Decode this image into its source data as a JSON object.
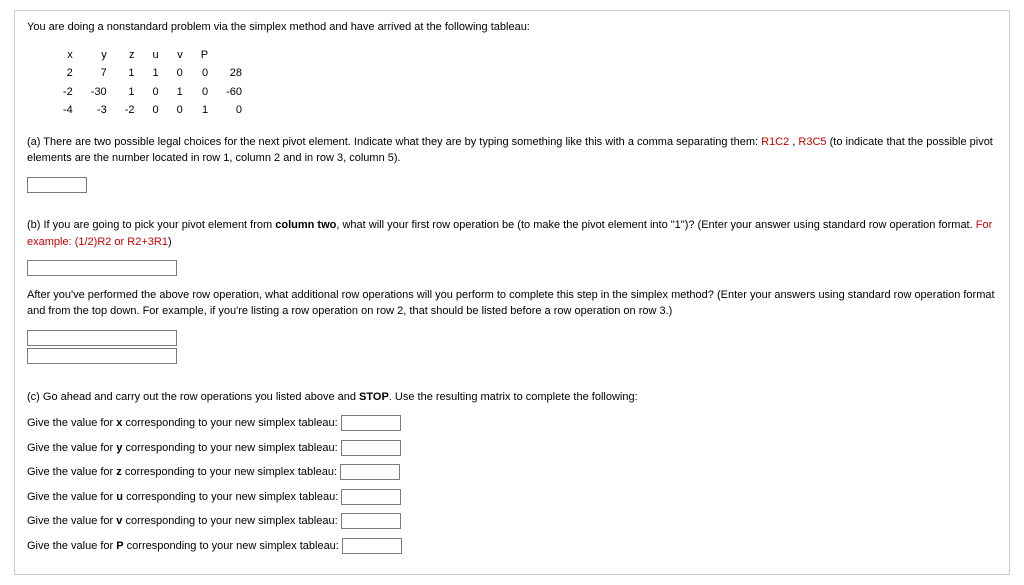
{
  "intro": "You are doing a nonstandard problem via the simplex method and have arrived at the following tableau:",
  "tableau": {
    "headers": [
      "x",
      "y",
      "z",
      "u",
      "v",
      "P",
      ""
    ],
    "rows": [
      [
        "2",
        "7",
        "1",
        "1",
        "0",
        "0",
        "28"
      ],
      [
        "-2",
        "-30",
        "1",
        "0",
        "1",
        "0",
        "-60"
      ],
      [
        "-4",
        "-3",
        "-2",
        "0",
        "0",
        "1",
        "0"
      ]
    ]
  },
  "partA": {
    "prefix": "(a) There are two possible legal choices for the next pivot element. Indicate what they are by typing something like this with a comma separating them: ",
    "ex1": "R1C2",
    "sep": " , ",
    "ex2": "R3C5",
    "suffix": " (to indicate that the possible pivot elements are the number located in row 1, column 2 and in row 3, column 5)."
  },
  "partB1": {
    "prefix": "(b) If you are going to pick your pivot element from ",
    "bold": "column two",
    "suffix": ", what will your first row operation be (to make the pivot element into \"1\")? (Enter your answer using standard row operation format. ",
    "example_lead": "For example:",
    "example_vals": " (1/2)R2 or R2+3R1",
    "close": ")"
  },
  "partB2": "After you've performed the above row operation, what additional row operations will you perform to complete this step in the simplex method? (Enter your answers using standard row operation format and from the top down. For example, if you're listing a row operation on row 2, that should be listed before a row operation on row 3.)",
  "partC": {
    "prefix": "(c) Go ahead and carry out the row operations you listed above and ",
    "stop": "STOP",
    "suffix": ". Use the resulting matrix to complete the following:"
  },
  "values": [
    {
      "pre": "Give the value for ",
      "var": "x",
      "post": " corresponding to your new simplex tableau:"
    },
    {
      "pre": "Give the value for ",
      "var": "y",
      "post": " corresponding to your new simplex tableau:"
    },
    {
      "pre": "Give the value for ",
      "var": "z",
      "post": " corresponding to your new simplex tableau:"
    },
    {
      "pre": "Give the value for ",
      "var": "u",
      "post": " corresponding to your new simplex tableau:"
    },
    {
      "pre": "Give the value for ",
      "var": "v",
      "post": " corresponding to your new simplex tableau:"
    },
    {
      "pre": "Give the value for ",
      "var": "P",
      "post": " corresponding to your new simplex tableau:"
    }
  ]
}
